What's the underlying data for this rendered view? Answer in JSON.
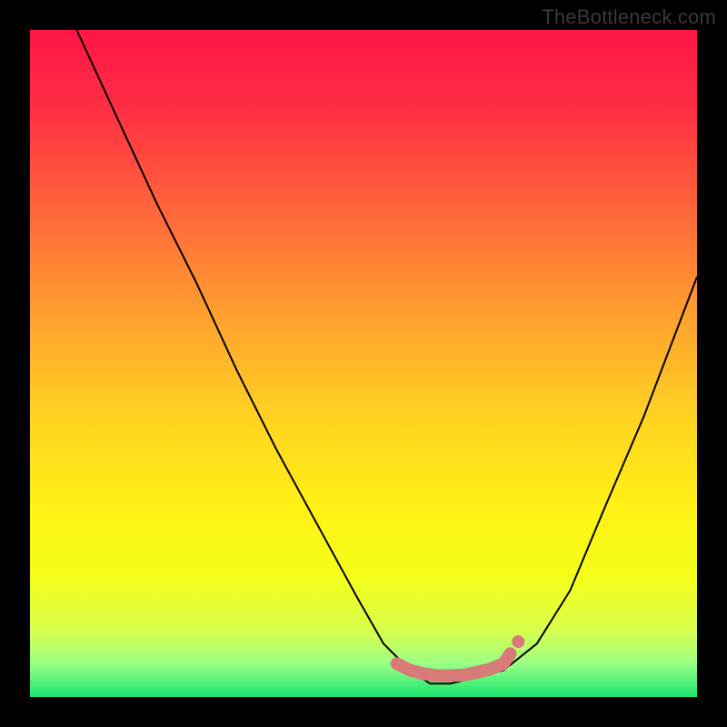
{
  "watermark": "TheBottleneck.com",
  "gradient_stops": [
    {
      "offset": 0.0,
      "color": "#ff1646"
    },
    {
      "offset": 0.12,
      "color": "#ff2f44"
    },
    {
      "offset": 0.28,
      "color": "#ff6a3a"
    },
    {
      "offset": 0.43,
      "color": "#ffa12f"
    },
    {
      "offset": 0.58,
      "color": "#ffd321"
    },
    {
      "offset": 0.72,
      "color": "#fff215"
    },
    {
      "offset": 0.82,
      "color": "#f5ff1a"
    },
    {
      "offset": 0.9,
      "color": "#d8ff4d"
    },
    {
      "offset": 0.95,
      "color": "#9cff86"
    },
    {
      "offset": 1.0,
      "color": "#17e66f"
    }
  ],
  "chart_data": {
    "type": "line",
    "title": "",
    "xlabel": "",
    "ylabel": "",
    "xlim": [
      0,
      100
    ],
    "ylim": [
      0,
      100
    ],
    "series": [
      {
        "name": "bottleneck-curve",
        "x": [
          7,
          13,
          19,
          25,
          31,
          37,
          43,
          49,
          53,
          57,
          60,
          63,
          67,
          71,
          76,
          81,
          86,
          92,
          100
        ],
        "y": [
          100,
          87,
          74,
          62,
          49,
          37,
          26,
          15,
          8,
          4,
          2,
          2,
          3,
          4,
          8,
          16,
          28,
          42,
          63
        ]
      },
      {
        "name": "optimal-band-marker",
        "x": [
          55,
          57,
          59,
          61,
          63,
          65,
          67,
          69,
          71,
          72
        ],
        "y": [
          5.0,
          4.0,
          3.5,
          3.2,
          3.2,
          3.3,
          3.7,
          4.2,
          5.0,
          6.5
        ]
      }
    ],
    "marker_color": "#d87b78",
    "curve_color": "#000000"
  }
}
